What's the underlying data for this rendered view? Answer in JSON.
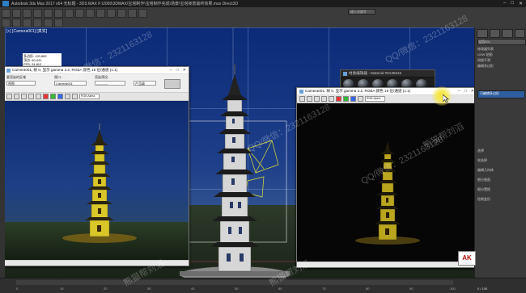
{
  "window": {
    "title": "Autodesk 3ds Max 2017 x64    无标题 - 3DS MAX    F:\\2000\\3DMAX\\宝塔制作\\宝塔制作完成\\场景\\宝塔夜景最终效果.max   Direct3D"
  },
  "ribbon": {
    "search_placeholder": "键入关键字"
  },
  "viewport": {
    "label": "[+] [Camera001] [真实]",
    "sky_color": "#0b2a78",
    "stats_lines": [
      "多边形: 120,882",
      "顶点: 60,441",
      "FPS: 24.812",
      "总计",
      "对象: 36",
      "几何体: 26",
      "图形: 2",
      "灯光: 6",
      "摄影机: 2",
      "辅助对象: 0"
    ]
  },
  "frame_left": {
    "title": "Camera001, 帧 0, 显示 gamma 2.2, RGBA 颜色 16 位/通道 (1:1)",
    "area_label": "要渲染的区域",
    "area_value": "视图",
    "viewport_label": "视口:",
    "viewport_value": "Camera001",
    "preset_label": "渲染预设:",
    "preset_value": "-----------",
    "render_label": "产品级",
    "channel": "RGB Alpha"
  },
  "frame_right": {
    "title": "Camera001, 帧 0, 显示 gamma 2.2, RGBA 颜色 16 位/通道 (1:1)",
    "channel": "RGB Alpha"
  },
  "material_editor": {
    "title": "材质编辑器 - Material #0135615"
  },
  "right_panel": {
    "name_field": "宝塔001",
    "rows": [
      "修改器列表",
      "UVW 贴图",
      "网格平滑",
      "编辑多边形",
      "可编辑多边形",
      "选择",
      "软选择",
      "编辑几何体",
      "细分曲面",
      "细分置换",
      "绘制变形"
    ],
    "selected": "可编辑多边形"
  },
  "status": {
    "ticks": [
      "0",
      "10",
      "20",
      "30",
      "40",
      "50",
      "60",
      "70",
      "80",
      "90",
      "100"
    ],
    "frame_counter": "0 / 100"
  },
  "watermarks": [
    "QQ/微信：2321163128",
    "QQ/微信：2321163128",
    "QQ/微信：2321163128",
    "QQ/微信：2321163128",
    "熊猫帮刘滔",
    "熊猫帮刘滔",
    "熊猫帮刘滔"
  ],
  "logo": "AK",
  "colors": {
    "tower_glow": "#d9c628",
    "lamp": "#f2e055"
  }
}
